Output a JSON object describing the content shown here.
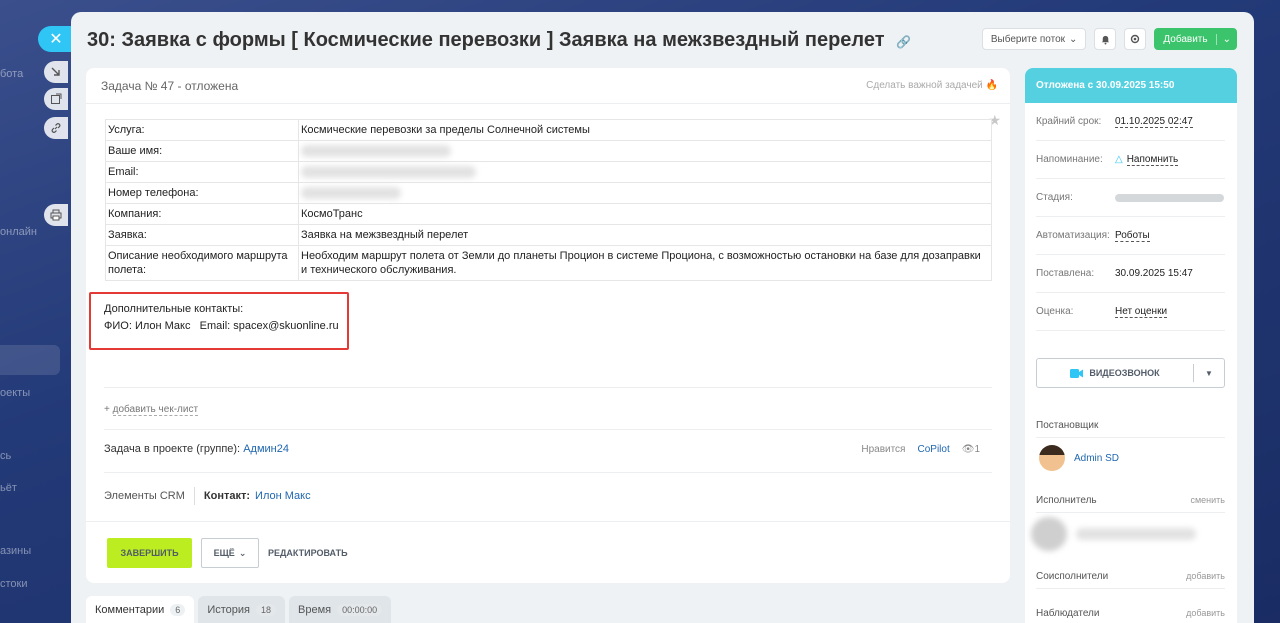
{
  "background": {
    "nav_fragments": [
      "бота",
      "онлайн",
      "оекты",
      "сь",
      "ьёт",
      "азины",
      "стоки"
    ]
  },
  "header": {
    "title": "30: Заявка с формы [ Космические перевозки ] Заявка на межзвездный перелет",
    "flow_select": "Выберите поток",
    "add_button": "Добавить"
  },
  "task": {
    "number_status": "Задача № 47 - отложена",
    "make_important": "Сделать важной задачей",
    "fields": [
      {
        "key": "Услуга:",
        "value": "Космические перевозки за пределы Солнечной системы",
        "blurred": false
      },
      {
        "key": "Ваше имя:",
        "value": "",
        "blurred": true
      },
      {
        "key": "Email:",
        "value": "",
        "blurred": true
      },
      {
        "key": "Номер телефона:",
        "value": "",
        "blurred": true
      },
      {
        "key": "Компания:",
        "value": "КосмоТранс",
        "blurred": false
      },
      {
        "key": "Заявка:",
        "value": "Заявка на межзвездный перелет",
        "blurred": false
      },
      {
        "key": "Описание необходимого маршрута полета:",
        "value": "Необходим маршрут полета от Земли до планеты Процион в системе Проциона, с возможностью остановки на базе для дозаправки и технического обслуживания.",
        "blurred": false
      }
    ],
    "extra_contacts_title": "Дополнительные контакты:",
    "extra_contacts_line": "ФИО: Илон Макс   Email: spacex@skuonline.ru",
    "add_checklist": "добавить чек-лист",
    "project_label": "Задача в проекте (группе):",
    "project_name": "Админ24",
    "likes_label": "Нравится",
    "copilot": "CoPilot",
    "views": "1",
    "crm_label": "Элементы CRM",
    "contact_label": "Контакт:",
    "contact_name": "Илон Макс",
    "btn_complete": "ЗАВЕРШИТЬ",
    "btn_more": "ЕЩЁ",
    "btn_edit": "РЕДАКТИРОВАТЬ"
  },
  "tabs": [
    {
      "label": "Комментарии",
      "count": "6"
    },
    {
      "label": "История",
      "count": "18"
    },
    {
      "label": "Время",
      "count": "00:00:00"
    }
  ],
  "sidebar": {
    "status": "Отложена с 30.09.2025 15:50",
    "deadline_label": "Крайний срок:",
    "deadline_value": "01.10.2025 02:47",
    "reminder_label": "Напоминание:",
    "reminder_value": "Напомнить",
    "stage_label": "Стадия:",
    "automation_label": "Автоматизация:",
    "automation_value": "Роботы",
    "created_label": "Поставлена:",
    "created_value": "30.09.2025 15:47",
    "rating_label": "Оценка:",
    "rating_value": "Нет оценки",
    "video_call": "ВИДЕОЗВОНОК",
    "creator_label": "Постановщик",
    "creator_name": "Admin SD",
    "assignee_label": "Исполнитель",
    "assignee_action": "сменить",
    "coassignees_label": "Соисполнители",
    "coassignees_action": "добавить",
    "observers_label": "Наблюдатели",
    "observers_action": "добавить"
  },
  "colors": {
    "status_header": "#55d0e0",
    "complete_button": "#bbed21",
    "add_button": "#3bc46c",
    "highlight_box": "#e53935",
    "link": "#2067b0"
  }
}
